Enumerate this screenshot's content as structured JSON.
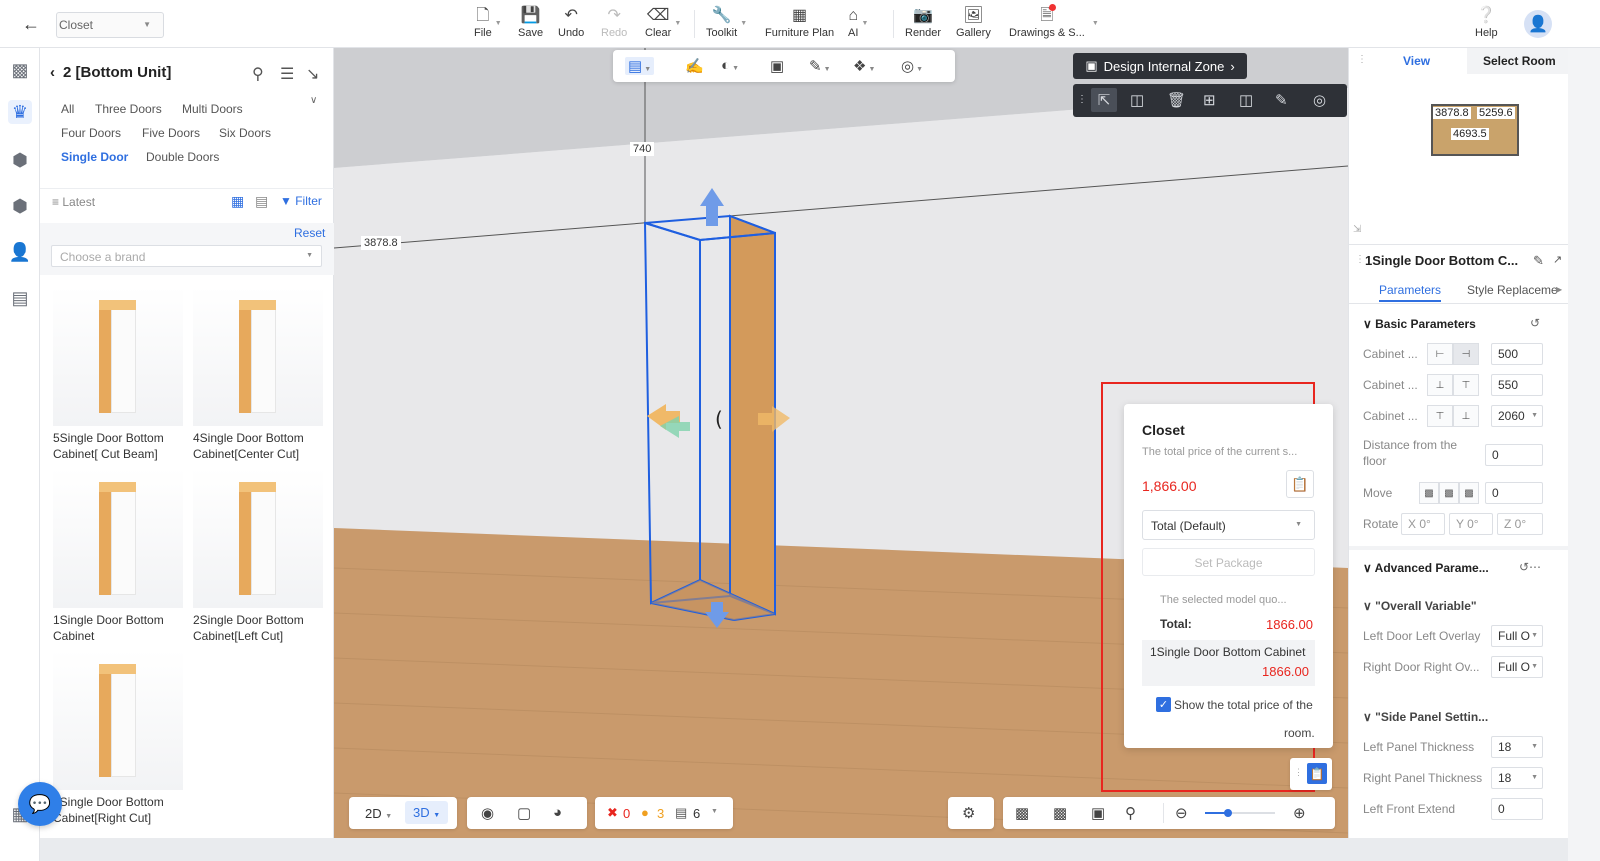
{
  "topbar": {
    "project": "Closet",
    "items": [
      {
        "label": "File",
        "icon": "file-icon",
        "caret": true
      },
      {
        "label": "Save",
        "icon": "save-icon"
      },
      {
        "label": "Undo",
        "icon": "undo-icon"
      },
      {
        "label": "Redo",
        "icon": "redo-icon",
        "disabled": true
      },
      {
        "label": "Clear",
        "icon": "eraser-icon",
        "caret": true
      },
      {
        "label": "Toolkit",
        "icon": "wrench-icon",
        "caret": true
      },
      {
        "label": "Furniture Plan",
        "icon": "furniture-plan-icon"
      },
      {
        "label": "AI",
        "icon": "ai-icon",
        "caret": true
      },
      {
        "label": "Render",
        "icon": "camera-icon"
      },
      {
        "label": "Gallery",
        "icon": "gallery-icon"
      },
      {
        "label": "Drawings & S...",
        "icon": "drawings-icon",
        "caret": true
      },
      {
        "label": "Help",
        "icon": "help-icon"
      }
    ]
  },
  "library": {
    "title": "2 [Bottom Unit]",
    "categories": [
      "All",
      "Three Doors",
      "Multi Doors",
      "Four Doors",
      "Five Doors",
      "Six Doors",
      "Single Door",
      "Double Doors"
    ],
    "active_category": "Single Door",
    "sort_label": "Latest",
    "filter_label": "Filter",
    "reset_label": "Reset",
    "brand_placeholder": "Choose a brand",
    "items": [
      {
        "name": "5Single Door Bottom Cabinet[ Cut Beam]"
      },
      {
        "name": "4Single Door Bottom Cabinet[Center Cut]"
      },
      {
        "name": "1Single Door Bottom Cabinet"
      },
      {
        "name": "2Single Door Bottom Cabinet[Left Cut]"
      },
      {
        "name": "3Single Door Bottom Cabinet[Right Cut]"
      }
    ]
  },
  "viewport": {
    "dim_height": "740",
    "dim_width": "3878.8",
    "design_zone_label": "Design Internal Zone",
    "view_2d": "2D",
    "view_3d": "3D",
    "errors": "0",
    "warnings": "3",
    "layers": "6"
  },
  "price_popup": {
    "title": "Closet",
    "subtitle": "The total price of the current s...",
    "price": "1,866.00",
    "select_value": "Total (Default)",
    "set_package": "Set Package",
    "selected_note": "The selected model quo...",
    "total_label": "Total:",
    "total_value": "1866.00",
    "item_name": "1Single Door Bottom Cabinet",
    "item_price": "1866.00",
    "show_total_label": "Show the total price of the",
    "show_total_label2": "room.",
    "show_total_checked": true
  },
  "right_panel": {
    "tabs": [
      "View",
      "Select Room"
    ],
    "active_tab": "View",
    "minimap_labels": [
      "3878.8",
      "5259.6",
      "4693.5"
    ],
    "object_title": "1Single Door Bottom C...",
    "sub_tabs": [
      "Parameters",
      "Style Replaceme"
    ],
    "basic_section": "Basic Parameters",
    "params": [
      {
        "label": "Cabinet ...",
        "value": "500"
      },
      {
        "label": "Cabinet ...",
        "value": "550"
      },
      {
        "label": "Cabinet ...",
        "value": "2060"
      }
    ],
    "distance_label": "Distance from the floor",
    "distance_value": "0",
    "move_label": "Move",
    "move_value": "0",
    "rotate_label": "Rotate",
    "rotate": [
      "X 0°",
      "Y 0°",
      "Z 0°"
    ],
    "advanced_section": "Advanced Parame...",
    "overall_section": "\"Overall Variable\"",
    "left_overlay_label": "Left Door Left Overlay",
    "left_overlay_value": "Full O",
    "right_overlay_label": "Right Door Right Ov...",
    "right_overlay_value": "Full O",
    "side_panel_section": "\"Side Panel Settin...",
    "left_thick_label": "Left Panel Thickness",
    "left_thick_value": "18",
    "right_thick_label": "Right Panel Thickness",
    "right_thick_value": "18",
    "left_front_label": "Left Front Extend",
    "left_front_value": "0"
  },
  "colors": {
    "accent": "#2f6fe0",
    "price_red": "#e8261f",
    "wood": "#d39a5b"
  }
}
